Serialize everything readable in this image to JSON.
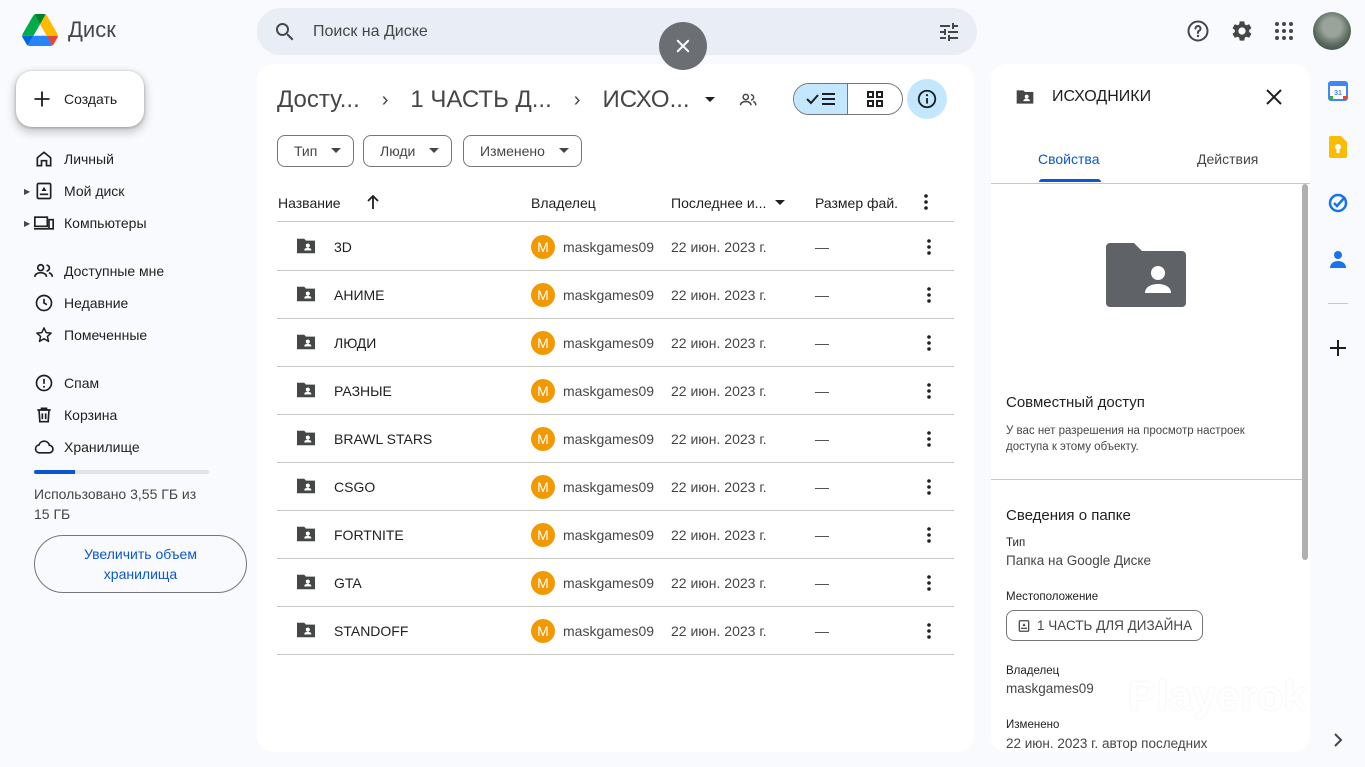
{
  "app": {
    "name": "Диск"
  },
  "search": {
    "placeholder": "Поиск на Диске"
  },
  "sidebar": {
    "create_label": "Создать",
    "items": [
      {
        "label": "Личный",
        "icon": "home-icon"
      },
      {
        "label": "Мой диск",
        "icon": "my-drive-icon"
      },
      {
        "label": "Компьютеры",
        "icon": "computers-icon"
      },
      {
        "label": "Доступные мне",
        "icon": "shared-icon"
      },
      {
        "label": "Недавние",
        "icon": "clock-icon"
      },
      {
        "label": "Помеченные",
        "icon": "star-icon"
      },
      {
        "label": "Спам",
        "icon": "spam-icon"
      },
      {
        "label": "Корзина",
        "icon": "trash-icon"
      },
      {
        "label": "Хранилище",
        "icon": "cloud-icon"
      }
    ],
    "storage": {
      "text": "Использовано 3,55 ГБ из 15 ГБ",
      "used_fraction": 0.237
    },
    "upgrade_label": "Увеличить объем хранилища"
  },
  "breadcrumb": {
    "items": [
      "Досту...",
      "1 ЧАСТЬ Д...",
      "ИСХО..."
    ]
  },
  "filters": [
    "Тип",
    "Люди",
    "Изменено"
  ],
  "table": {
    "headers": {
      "name": "Название",
      "owner": "Владелец",
      "modified": "Последнее и...",
      "size": "Размер фай."
    },
    "rows": [
      {
        "name": "3D",
        "owner_initial": "M",
        "owner": "maskgames09",
        "modified": "22 июн. 2023 г.",
        "size": "—"
      },
      {
        "name": "АНИМЕ",
        "owner_initial": "M",
        "owner": "maskgames09",
        "modified": "22 июн. 2023 г.",
        "size": "—"
      },
      {
        "name": "ЛЮДИ",
        "owner_initial": "M",
        "owner": "maskgames09",
        "modified": "22 июн. 2023 г.",
        "size": "—"
      },
      {
        "name": "РАЗНЫЕ",
        "owner_initial": "M",
        "owner": "maskgames09",
        "modified": "22 июн. 2023 г.",
        "size": "—"
      },
      {
        "name": "BRAWL STARS",
        "owner_initial": "M",
        "owner": "maskgames09",
        "modified": "22 июн. 2023 г.",
        "size": "—"
      },
      {
        "name": "CSGO",
        "owner_initial": "M",
        "owner": "maskgames09",
        "modified": "22 июн. 2023 г.",
        "size": "—"
      },
      {
        "name": "FORTNITE",
        "owner_initial": "M",
        "owner": "maskgames09",
        "modified": "22 июн. 2023 г.",
        "size": "—"
      },
      {
        "name": "GTA",
        "owner_initial": "M",
        "owner": "maskgames09",
        "modified": "22 июн. 2023 г.",
        "size": "—"
      },
      {
        "name": "STANDOFF",
        "owner_initial": "M",
        "owner": "maskgames09",
        "modified": "22 июн. 2023 г.",
        "size": "—"
      }
    ]
  },
  "details": {
    "title": "ИСХОДНИКИ",
    "tabs": {
      "properties": "Свойства",
      "actions": "Действия"
    },
    "sharing": {
      "title": "Совместный доступ",
      "text": "У вас нет разрешения на просмотр настроек доступа к этому объекту."
    },
    "folder_info": {
      "title": "Сведения о папке",
      "type_label": "Тип",
      "type_value": "Папка на Google Диске",
      "location_label": "Местоположение",
      "location_value": "1 ЧАСТЬ ДЛЯ ДИЗАЙНА",
      "owner_label": "Владелец",
      "owner_value": "maskgames09",
      "modified_label": "Изменено",
      "modified_value": "22 июн. 2023 г. автор последних"
    }
  },
  "watermark": "Playerok",
  "colors": {
    "accent": "#0b57d0",
    "selected": "#c2e7ff",
    "owner_avatar": "#f29900"
  }
}
